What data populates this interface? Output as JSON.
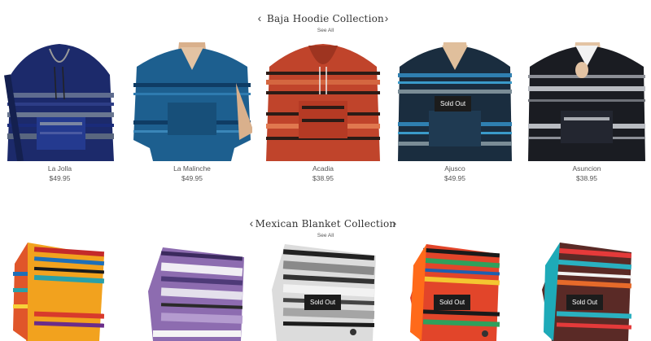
{
  "colors": {
    "sold_out_bg": "#1c1c1c",
    "text": "#555555"
  },
  "collections": [
    {
      "title": "Baja Hoodie Collection",
      "see_all": "See All",
      "prev_icon": "chevron-left-icon",
      "next_icon": "chevron-right-icon",
      "products": [
        {
          "name": "La Jolla",
          "price": "$49.95",
          "sold_out": false
        },
        {
          "name": "La Malinche",
          "price": "$49.95",
          "sold_out": false
        },
        {
          "name": "Acadia",
          "price": "$38.95",
          "sold_out": false
        },
        {
          "name": "Ajusco",
          "price": "$49.95",
          "sold_out": true
        },
        {
          "name": "Asuncion",
          "price": "$38.95",
          "sold_out": false
        }
      ]
    },
    {
      "title": "Mexican Blanket Collection",
      "see_all": "See All",
      "prev_icon": "chevron-left-icon",
      "next_icon": "chevron-right-icon",
      "products": [
        {
          "sold_out": false
        },
        {
          "sold_out": false
        },
        {
          "sold_out": true
        },
        {
          "sold_out": true
        },
        {
          "sold_out": true
        }
      ]
    }
  ],
  "sold_out_label": "Sold Out",
  "glyphs": {
    "prev": "‹",
    "next": "›"
  }
}
